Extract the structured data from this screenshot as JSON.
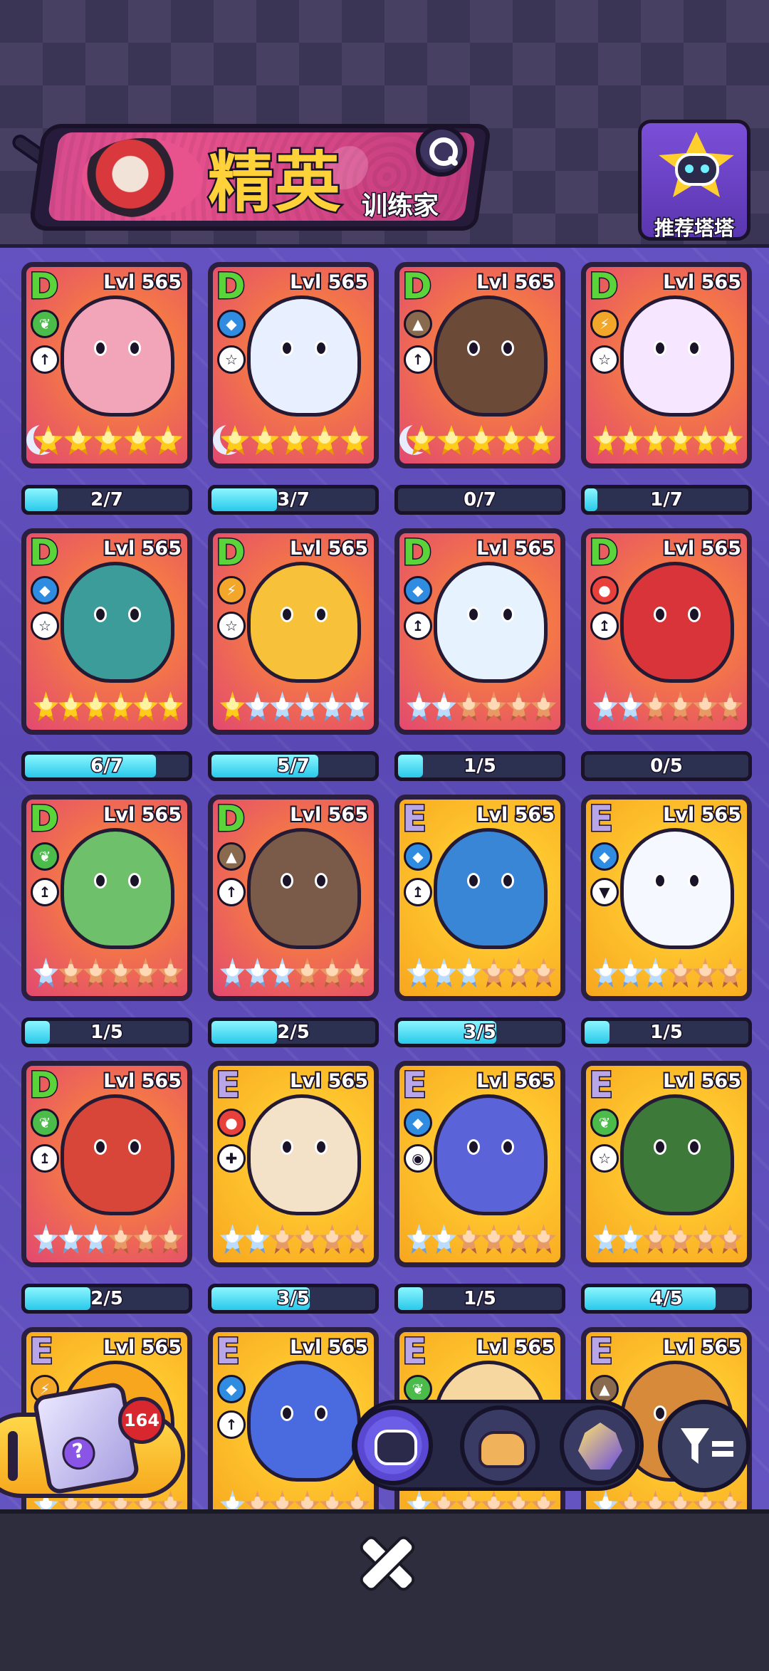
{
  "header": {
    "title": "精英",
    "subtitle": "训练家",
    "recommend_label": "推荐塔塔"
  },
  "cards": [
    {
      "grade": "D",
      "level": "Lvl 565",
      "element": "leaf",
      "role": "attack",
      "moon": true,
      "stars": [
        "gold",
        "gold",
        "gold",
        "gold",
        "gold"
      ],
      "progress": "2/7",
      "fill": 0.2,
      "color": "#f2a4b8"
    },
    {
      "grade": "D",
      "level": "Lvl 565",
      "element": "water",
      "role": "support",
      "moon": true,
      "stars": [
        "gold",
        "gold",
        "gold",
        "gold",
        "gold"
      ],
      "progress": "3/7",
      "fill": 0.4,
      "color": "#e8f0ff"
    },
    {
      "grade": "D",
      "level": "Lvl 565",
      "element": "earth",
      "role": "attack",
      "moon": true,
      "stars": [
        "gold",
        "gold",
        "gold",
        "gold",
        "gold"
      ],
      "progress": "0/7",
      "fill": 0.0,
      "color": "#6b4a38"
    },
    {
      "grade": "D",
      "level": "Lvl 565",
      "element": "bolt",
      "role": "support",
      "moon": false,
      "stars": [
        "gold",
        "gold",
        "gold",
        "gold",
        "gold",
        "gold"
      ],
      "progress": "1/7",
      "fill": 0.08,
      "color": "#f6e6ff"
    },
    {
      "grade": "D",
      "level": "Lvl 565",
      "element": "water",
      "role": "support",
      "moon": false,
      "stars": [
        "gold",
        "gold",
        "gold",
        "gold",
        "gold",
        "gold"
      ],
      "progress": "6/7",
      "fill": 0.8,
      "color": "#3b9c9a"
    },
    {
      "grade": "D",
      "level": "Lvl 565",
      "element": "bolt",
      "role": "support",
      "moon": false,
      "stars": [
        "gold",
        "silver",
        "silver",
        "silver",
        "silver",
        "silver"
      ],
      "progress": "5/7",
      "fill": 0.65,
      "color": "#f7c23a"
    },
    {
      "grade": "D",
      "level": "Lvl 565",
      "element": "water",
      "role": "speed",
      "moon": false,
      "stars": [
        "silver",
        "silver",
        "bronze",
        "bronze",
        "bronze",
        "bronze"
      ],
      "progress": "1/5",
      "fill": 0.15,
      "color": "#e6f3ff"
    },
    {
      "grade": "D",
      "level": "Lvl 565",
      "element": "fire",
      "role": "speed",
      "moon": false,
      "stars": [
        "silver",
        "silver",
        "bronze",
        "bronze",
        "bronze",
        "bronze"
      ],
      "progress": "0/5",
      "fill": 0.0,
      "color": "#d8343a"
    },
    {
      "grade": "D",
      "level": "Lvl 565",
      "element": "leaf",
      "role": "speed",
      "moon": false,
      "stars": [
        "silver",
        "bronze",
        "bronze",
        "bronze",
        "bronze",
        "bronze"
      ],
      "progress": "1/5",
      "fill": 0.15,
      "color": "#6fc06a"
    },
    {
      "grade": "D",
      "level": "Lvl 565",
      "element": "earth",
      "role": "attack",
      "moon": false,
      "stars": [
        "silver",
        "silver",
        "silver",
        "bronze",
        "bronze",
        "bronze"
      ],
      "progress": "2/5",
      "fill": 0.4,
      "color": "#7a5a48"
    },
    {
      "grade": "E",
      "level": "Lvl 565",
      "element": "water",
      "role": "speed",
      "moon": false,
      "stars": [
        "silver",
        "silver",
        "silver",
        "bronze",
        "bronze",
        "bronze"
      ],
      "progress": "3/5",
      "fill": 0.6,
      "color": "#3a86d6"
    },
    {
      "grade": "E",
      "level": "Lvl 565",
      "element": "water",
      "role": "defense",
      "moon": false,
      "stars": [
        "silver",
        "silver",
        "silver",
        "bronze",
        "bronze",
        "bronze"
      ],
      "progress": "1/5",
      "fill": 0.15,
      "color": "#f5f8ff"
    },
    {
      "grade": "D",
      "level": "Lvl 565",
      "element": "leaf",
      "role": "speed",
      "moon": false,
      "stars": [
        "silver",
        "silver",
        "silver",
        "bronze",
        "bronze",
        "bronze"
      ],
      "progress": "2/5",
      "fill": 0.4,
      "color": "#d8463a"
    },
    {
      "grade": "E",
      "level": "Lvl 565",
      "element": "fire",
      "role": "heal",
      "moon": false,
      "stars": [
        "silver",
        "silver",
        "bronze",
        "bronze",
        "bronze",
        "bronze"
      ],
      "progress": "3/5",
      "fill": 0.6,
      "color": "#f4e2c8"
    },
    {
      "grade": "E",
      "level": "Lvl 565",
      "element": "water",
      "role": "eye",
      "moon": false,
      "stars": [
        "silver",
        "silver",
        "bronze",
        "bronze",
        "bronze",
        "bronze"
      ],
      "progress": "1/5",
      "fill": 0.15,
      "color": "#5a63d8"
    },
    {
      "grade": "E",
      "level": "Lvl 565",
      "element": "leaf",
      "role": "support",
      "moon": false,
      "stars": [
        "silver",
        "silver",
        "bronze",
        "bronze",
        "bronze",
        "bronze"
      ],
      "progress": "4/5",
      "fill": 0.8,
      "color": "#3d7a3a"
    },
    {
      "grade": "E",
      "level": "Lvl 565",
      "element": "bolt",
      "role": "",
      "moon": false,
      "stars": [
        "silver",
        "bronze",
        "bronze",
        "bronze",
        "bronze",
        "bronze"
      ],
      "progress": "",
      "fill": 0.0,
      "color": "#f7a61e"
    },
    {
      "grade": "E",
      "level": "Lvl 565",
      "element": "water",
      "role": "attack",
      "moon": false,
      "stars": [
        "silver",
        "bronze",
        "bronze",
        "bronze",
        "bronze",
        "bronze"
      ],
      "progress": "",
      "fill": 0.0,
      "color": "#4a6ae0"
    },
    {
      "grade": "E",
      "level": "Lvl 565",
      "element": "leaf",
      "role": "",
      "moon": false,
      "stars": [
        "silver",
        "bronze",
        "bronze",
        "bronze",
        "bronze",
        "bronze"
      ],
      "progress": "",
      "fill": 0.0,
      "color": "#f7d7a0"
    },
    {
      "grade": "E",
      "level": "Lvl 565",
      "element": "earth",
      "role": "",
      "moon": false,
      "stars": [
        "silver",
        "bronze",
        "bronze",
        "bronze",
        "bronze",
        "bronze"
      ],
      "progress": "",
      "fill": 0.0,
      "color": "#d68a3a"
    }
  ],
  "mystery_box": {
    "count": "164"
  },
  "filters": {
    "items": [
      "creature-filter",
      "bread-filter",
      "gem-filter"
    ],
    "active": "creature-filter"
  }
}
